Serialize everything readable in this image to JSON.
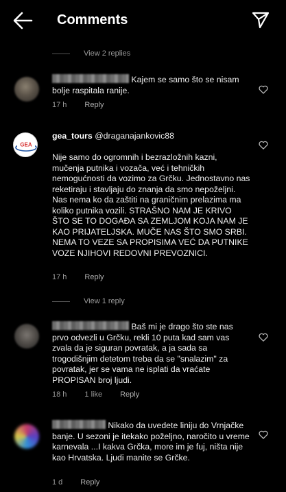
{
  "header": {
    "title": "Comments"
  },
  "comments": [
    {
      "text": "Kajem se samo što se nisam bolje raspitala ranije.",
      "time": "17 h",
      "reply": "Reply"
    },
    {
      "username": "gea_tours",
      "mention": "@draganajankovic88",
      "text": "Nije samo do ogromnih i bezrazložnih kazni, mučenja putnika i vozača, već i tehničkih nemogućnosti da vozimo za Grčku. Jednostavno nas reketiraju i stavljaju do znanja da smo nepoželjni. Nas nema ko da zaštiti na graničnim prelazima ma koliko putnika vozili. STRAŠNO NAM JE KRIVO ŠTO SE TO DOGAĐA SA ZEMLJOM KOJA NAM JE KAO PRIJATELJSKA. MUČE NAS ŠTO SMO SRBI. NEMA TO VEZE SA PROPISIMA VEĆ DA PUTNIKE VOZE NJIHOVI REDOVNI PREVOZNICI.",
      "time": "17 h",
      "reply": "Reply"
    },
    {
      "text": "Baš mi je drago što ste nas prvo odvezli u Grčku, rekli 10 puta kad sam vas zvala da je siguran povratak, a ja sada sa trogodišnjim detetom treba da se \"snalazim\" za povratak, jer se vama ne isplati da vraćate PROPISAN broj ljudi.",
      "time": "18 h",
      "likes": "1 like",
      "reply": "Reply"
    },
    {
      "text": "Nikako da uvedete liniju do Vrnjačke banje. U sezoni je itekako poželjno, naročito u vreme karnevala ...I kakva Grčka, more im je fuj, ništa nije kao Hrvatska. Ljudi manite se Grčke.",
      "time": "1 d",
      "reply": "Reply"
    }
  ],
  "view_replies_top": "View 2 replies",
  "view_reply_mid": "View 1 reply",
  "logo_text": "GEA"
}
